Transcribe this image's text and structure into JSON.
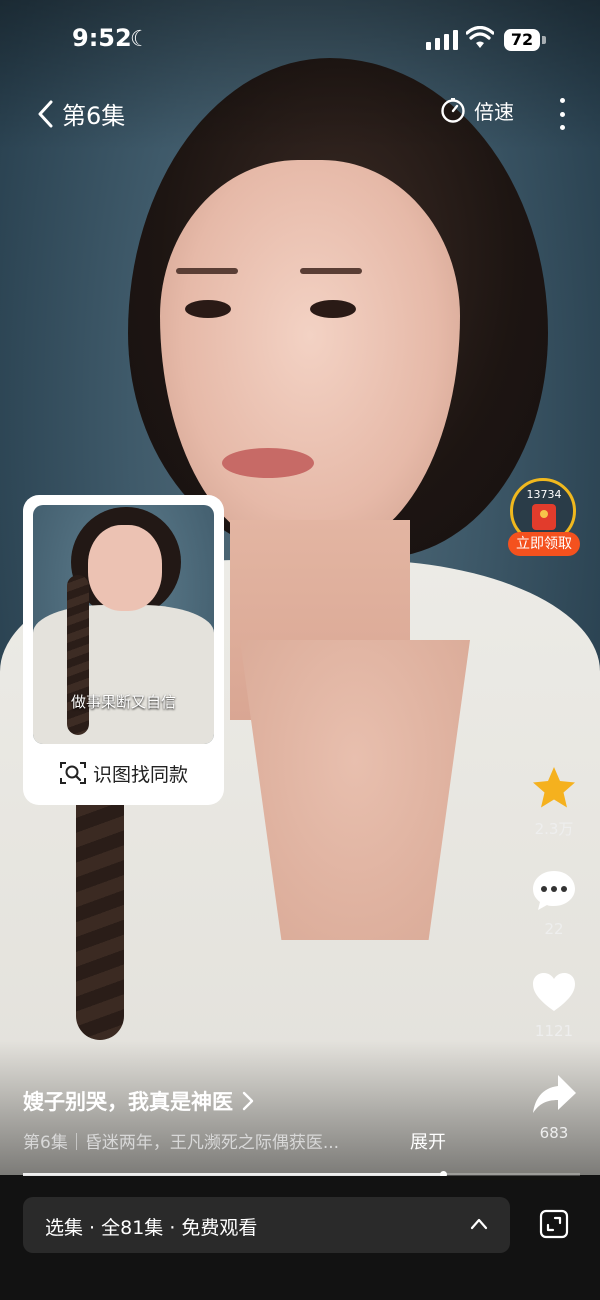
{
  "status_bar": {
    "time": "9:52",
    "battery": "72"
  },
  "top_nav": {
    "episode_title": "第6集",
    "speed_label": "倍速"
  },
  "product_card": {
    "caption": "做事果断又自信",
    "button_label": "识图找同款"
  },
  "reward": {
    "count": "13734",
    "button_label": "立即领取"
  },
  "actions": {
    "favorite_count": "2.3万",
    "comment_count": "22",
    "like_count": "1121",
    "share_count": "683"
  },
  "info": {
    "title": "嫂子别哭，我真是神医",
    "description": "第6集｜昏迷两年，王凡濒死之际偶获医...",
    "expand_label": "展开"
  },
  "playback": {
    "progress": 0.754
  },
  "episode_bar": {
    "label": "选集 · 全81集 · 免费观看"
  },
  "colors": {
    "accent_star": "#f5b11e",
    "reward_orange": "#f4511e",
    "bottom_bg": "#121212"
  }
}
